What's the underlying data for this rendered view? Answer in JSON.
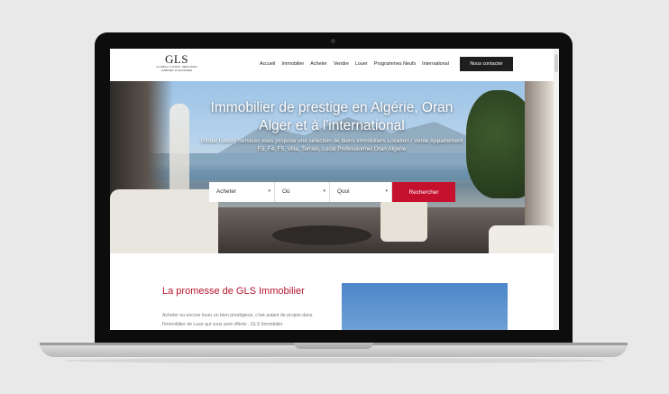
{
  "logo": {
    "main": "GLS",
    "sub": "GLOBAL LUXURY SERVICES",
    "tagline": "CABINET D'AFFAIRES"
  },
  "nav": {
    "items": [
      "Accueil",
      "Immobilier",
      "Acheter",
      "Vendre",
      "Louer",
      "Programmes Neufs",
      "International"
    ]
  },
  "contact_button": "Nous contacter",
  "hero": {
    "title_line1": "Immobilier de prestige en Algérie, Oran",
    "title_line2": "Alger et à l'international",
    "subtitle": "Global Luxury Services vous propose une sélection de biens immobiliers Location / Vente Appartement F3, F4, F5, Villa, Terrain, Local Professionnel Oran Algerie"
  },
  "search": {
    "type_value": "Acheter",
    "where_value": "Où",
    "what_value": "Quoi",
    "button_label": "Rechercher"
  },
  "content": {
    "title": "La promesse de GLS Immobilier",
    "text": "Acheter ou encore louer un bien prestigieux, c'est autant de projets dans l'immobilier de Luxe qui vous sont offerts . GLS Immobilier"
  },
  "colors": {
    "accent": "#c5102e",
    "dark_button": "#1e1e1e"
  }
}
